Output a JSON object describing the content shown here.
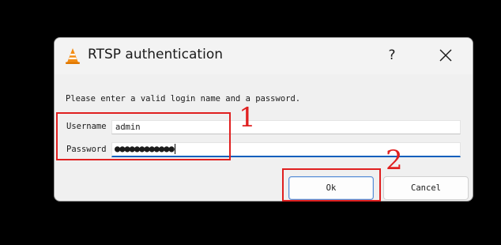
{
  "window": {
    "title": "RTSP authentication",
    "icon": "vlc-cone-icon",
    "help_label": "?",
    "close_icon": "close-icon"
  },
  "form": {
    "prompt": "Please enter a valid login name and a password.",
    "username_label": "Username",
    "username_value": "admin",
    "password_label": "Password",
    "password_masked": "●●●●●●●●●●●●"
  },
  "buttons": {
    "ok_label": "Ok",
    "cancel_label": "Cancel"
  },
  "annotations": {
    "marker_1": "1",
    "marker_2": "2",
    "color": "#e02020"
  },
  "colors": {
    "focus_accent": "#0a5fbd",
    "background": "#000000",
    "dialog_bg": "#f0f0f0"
  }
}
